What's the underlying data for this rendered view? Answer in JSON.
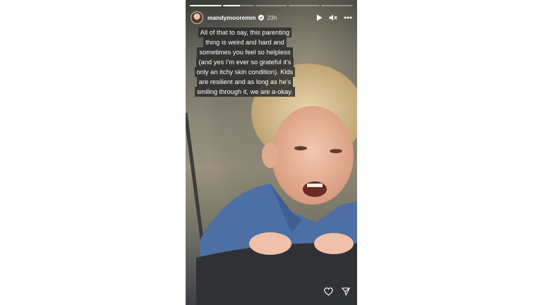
{
  "story": {
    "username": "mandymooremm",
    "time_ago": "23h",
    "progress": [
      1.0,
      0.55,
      0,
      0,
      0
    ],
    "caption_lines": [
      "All of that to say, this parenting",
      "thing is weird and hard and",
      "sometimes you feel so helpless",
      "(and yes I’m ever so grateful it’s",
      "only an itchy skin condition). Kids",
      "are resilient and as long as he’s",
      "smiling through it, we are a-okay."
    ]
  },
  "icons": {
    "play": "play-icon",
    "mute": "mute-icon",
    "more": "more-icon",
    "like": "heart-icon",
    "share": "send-icon",
    "verified": "verified-badge-icon"
  },
  "colors": {
    "text": "#ffffff",
    "caption_bg": "#282828",
    "page_bg": "#ffffff"
  }
}
